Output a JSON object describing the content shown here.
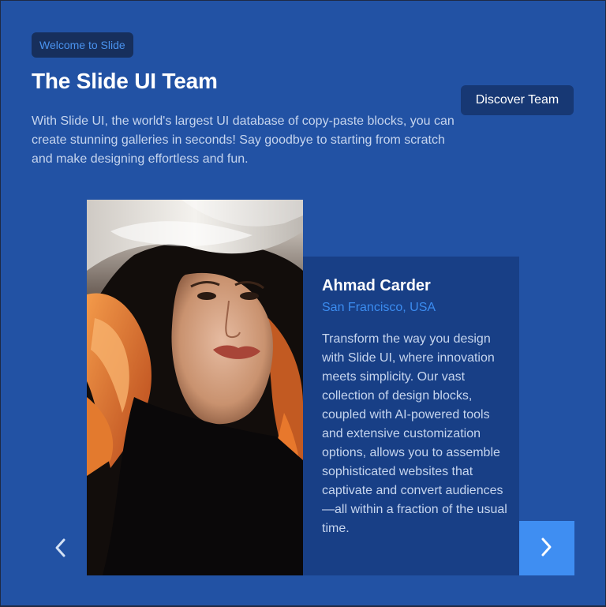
{
  "header": {
    "badge": "Welcome to Slide",
    "title": "The Slide UI Team",
    "description": "With Slide UI, the world's largest UI database of copy-paste blocks, you can create stunning galleries in seconds! Say goodbye to starting from scratch and make designing effortless and fun.",
    "discover_button": "Discover Team"
  },
  "member": {
    "name": "Ahmad Carder",
    "location": "San Francisco, USA",
    "bio": "Transform the way you design with Slide UI, where innovation meets simplicity. Our vast collection of design blocks, coupled with AI-powered tools and extensive customization options, allows you to assemble sophisticated websites that captivate and convert audiences—all within a fraction of the usual time.",
    "photo_alt": "portrait-photo"
  },
  "carousel": {
    "prev_icon": "chevron-left-icon",
    "next_icon": "chevron-right-icon"
  },
  "colors": {
    "background": "#2252a4",
    "card": "#183f86",
    "accent": "#3f8ef2",
    "badge_text": "#4a93ef"
  }
}
